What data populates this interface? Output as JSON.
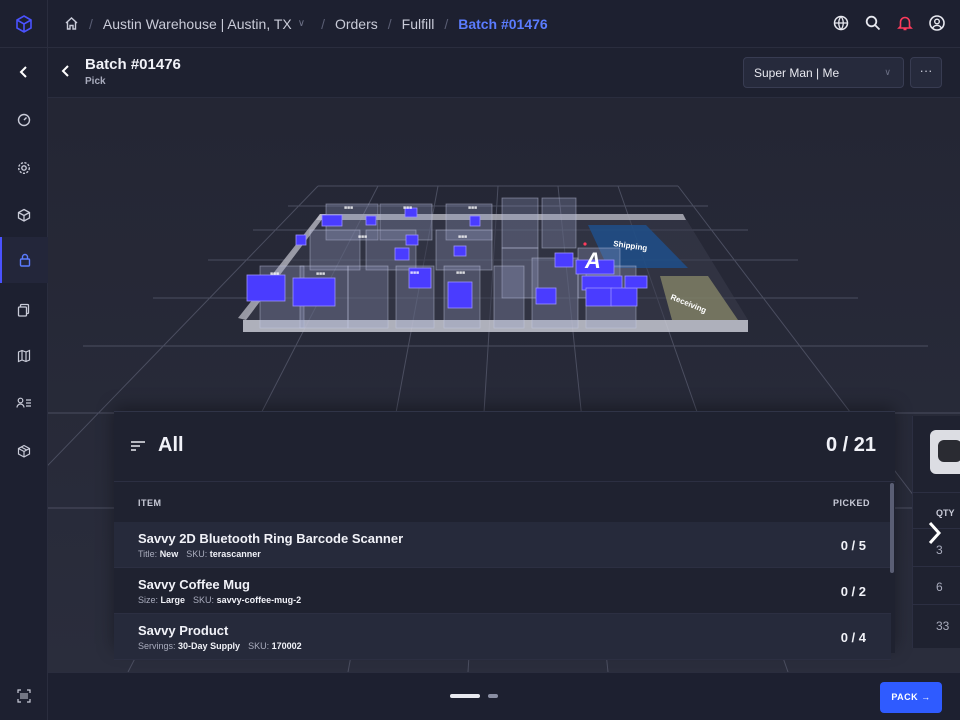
{
  "breadcrumb": {
    "location": "Austin Warehouse | Austin, TX",
    "orders": "Orders",
    "fulfill": "Fulfill",
    "batch": "Batch #01476"
  },
  "header": {
    "title": "Batch #01476",
    "subtitle": "Pick",
    "user_select": "Super Man | Me",
    "more": "···"
  },
  "map": {
    "zones": {
      "shipping": "Shipping",
      "receiving": "Receiving"
    },
    "marker": "A"
  },
  "pick_list": {
    "filter": "All",
    "progress": "0 / 21",
    "col_item": "ITEM",
    "col_picked": "PICKED",
    "rows": [
      {
        "name": "Savvy 2D Bluetooth Ring Barcode Scanner",
        "k1": "Title:",
        "v1": "New",
        "k2": "SKU:",
        "v2": "terascanner",
        "picked": "0 / 5"
      },
      {
        "name": "Savvy Coffee Mug",
        "k1": "Size:",
        "v1": "Large",
        "k2": "SKU:",
        "v2": "savvy-coffee-mug-2",
        "picked": "0 / 2"
      },
      {
        "name": "Savvy Product",
        "k1": "Servings:",
        "v1": "30-Day Supply",
        "k2": "SKU:",
        "v2": "170002",
        "picked": "0 / 4"
      }
    ]
  },
  "peek": {
    "qty_header": "QTY",
    "values": [
      "3",
      "6",
      "33"
    ]
  },
  "footer": {
    "pack_label": "PACK →"
  },
  "colors": {
    "accent": "#2f5bff",
    "breadcrumb_active": "#5b7cff",
    "bin": "#4a3cff",
    "shipping_zone": "#1f4f8a",
    "receiving_zone": "#8a8a6a"
  }
}
